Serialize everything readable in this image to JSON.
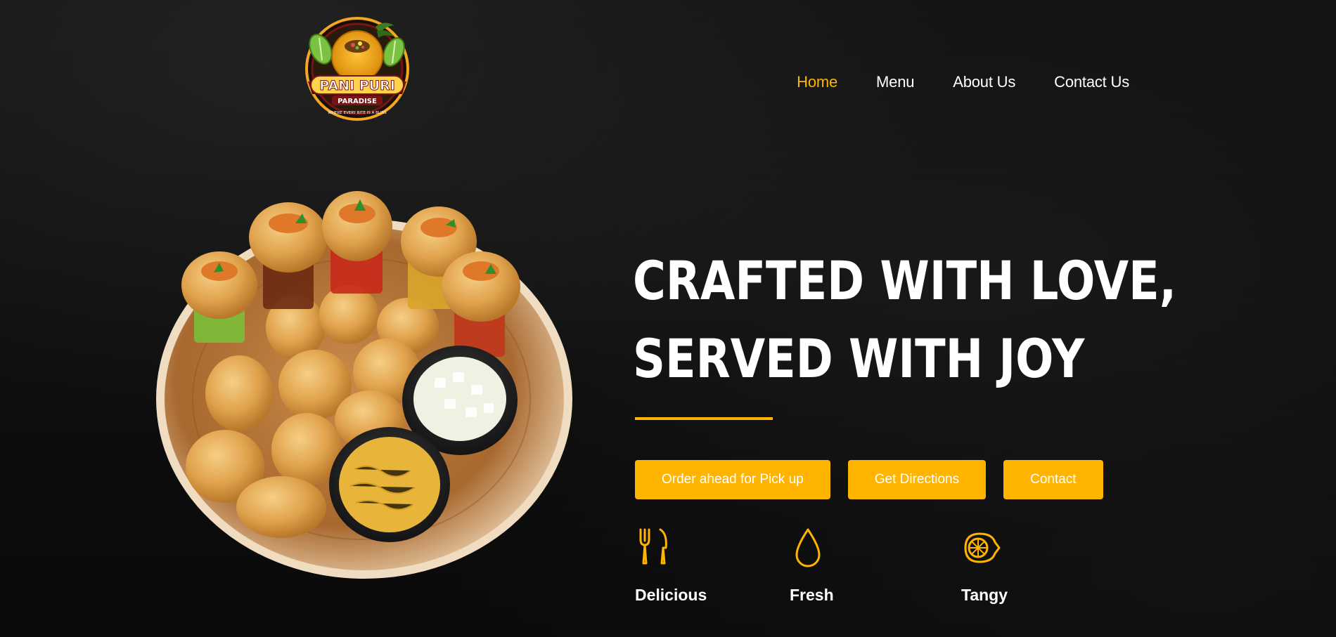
{
  "brand": {
    "logo_text_main": "PANI PURI",
    "logo_text_sub": "PARADISE",
    "logo_tagline": "WHERE EVERY BITE IS A BLISS"
  },
  "nav": {
    "items": [
      {
        "label": "Home",
        "active": true
      },
      {
        "label": "Menu",
        "active": false
      },
      {
        "label": "About Us",
        "active": false
      },
      {
        "label": "Contact Us",
        "active": false
      }
    ]
  },
  "hero": {
    "headline_line1": "CRAFTED WITH LOVE,",
    "headline_line2": "SERVED WITH JOY",
    "buttons": {
      "order": "Order ahead for Pick up",
      "directions": "Get Directions",
      "contact": "Contact"
    },
    "features": [
      {
        "label": "Delicious",
        "icon": "fork-knife-icon"
      },
      {
        "label": "Fresh",
        "icon": "water-drop-icon"
      },
      {
        "label": "Tangy",
        "icon": "lemon-icon"
      }
    ]
  },
  "colors": {
    "accent": "#ffb400",
    "background": "#0b0b0b",
    "text": "#ffffff"
  }
}
